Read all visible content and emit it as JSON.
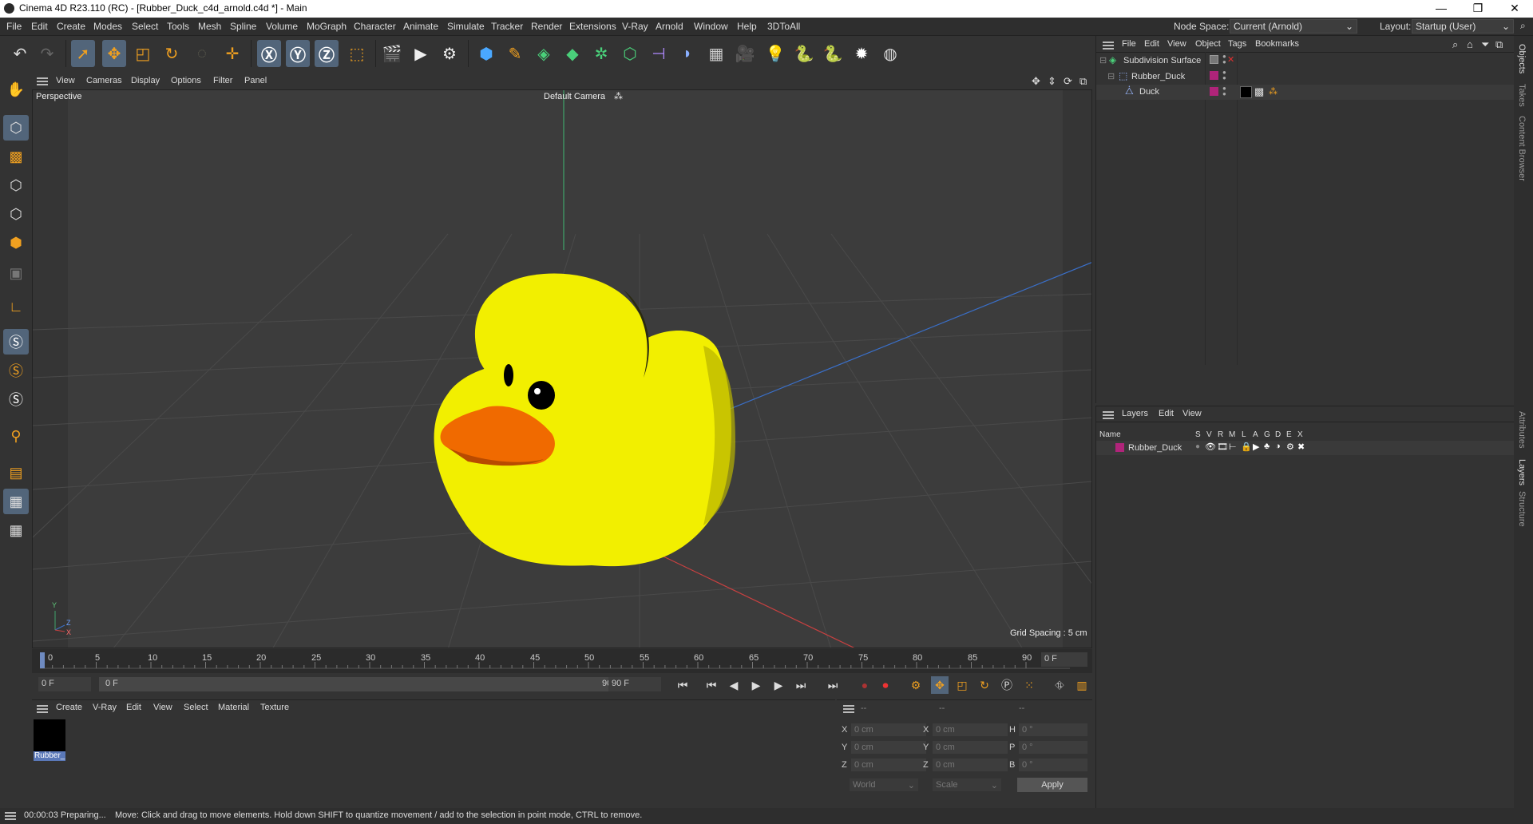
{
  "window": {
    "title": "Cinema 4D R23.110 (RC) - [Rubber_Duck_c4d_arnold.c4d *] - Main",
    "min": "—",
    "max": "❐",
    "close": "✕"
  },
  "menu": [
    "File",
    "Edit",
    "Create",
    "Modes",
    "Select",
    "Tools",
    "Mesh",
    "Spline",
    "Volume",
    "MoGraph",
    "Character",
    "Animate",
    "Simulate",
    "Tracker",
    "Render",
    "Extensions",
    "V-Ray",
    "Arnold",
    "Window",
    "Help",
    "3DToAll"
  ],
  "nodespace": {
    "label": "Node Space:",
    "value": "Current (Arnold)"
  },
  "layout": {
    "label": "Layout:",
    "value": "Startup (User)"
  },
  "viewport": {
    "menu": [
      "View",
      "Cameras",
      "Display",
      "Options",
      "Filter",
      "Panel"
    ],
    "view_name": "Perspective",
    "camera": "Default Camera",
    "grid_spacing": "Grid Spacing : 5 cm",
    "axes": {
      "y": "Y",
      "z": "Z",
      "x": "X"
    }
  },
  "timeline": {
    "ticks": [
      "0",
      "5",
      "10",
      "15",
      "20",
      "25",
      "30",
      "35",
      "40",
      "45",
      "50",
      "55",
      "60",
      "65",
      "70",
      "75",
      "80",
      "85",
      "90"
    ],
    "current_frame": "0 F",
    "start": "0 F",
    "range_start": "0 F",
    "range_end": "90 F",
    "end": "90 F",
    "frame_display": "0 F"
  },
  "material_panel": {
    "menu": [
      "Create",
      "V-Ray",
      "Edit",
      "View",
      "Select",
      "Material",
      "Texture"
    ],
    "materials": [
      {
        "name": "Rubber_"
      }
    ]
  },
  "coords": {
    "headers": [
      "--",
      "--",
      "--"
    ],
    "rows": [
      {
        "a": "X",
        "av": "0 cm",
        "b": "X",
        "bv": "0 cm",
        "c": "H",
        "cv": "0 °"
      },
      {
        "a": "Y",
        "av": "0 cm",
        "b": "Y",
        "bv": "0 cm",
        "c": "P",
        "cv": "0 °"
      },
      {
        "a": "Z",
        "av": "0 cm",
        "b": "Z",
        "bv": "0 cm",
        "c": "B",
        "cv": "0 °"
      }
    ],
    "space": "World",
    "mode": "Scale",
    "apply": "Apply"
  },
  "objects_panel": {
    "menu": [
      "File",
      "Edit",
      "View",
      "Object",
      "Tags",
      "Bookmarks"
    ],
    "items": [
      {
        "name": "Subdivision Surface",
        "indent": 0
      },
      {
        "name": "Rubber_Duck",
        "indent": 1
      },
      {
        "name": "Duck",
        "indent": 2
      }
    ]
  },
  "layers_panel": {
    "menu": [
      "Layers",
      "Edit",
      "View"
    ],
    "columns": [
      "Name",
      "S",
      "V",
      "R",
      "M",
      "L",
      "A",
      "G",
      "D",
      "E",
      "X"
    ],
    "items": [
      {
        "name": "Rubber_Duck",
        "color": "#b0247a"
      }
    ]
  },
  "right_tabs": [
    "Objects",
    "Takes",
    "Content Browser",
    "Attributes",
    "Layers",
    "Structure"
  ],
  "status": {
    "time": "00:00:03 Preparing...",
    "message": "Move: Click and drag to move elements. Hold down SHIFT to quantize movement / add to the selection in point mode, CTRL to remove."
  },
  "colors": {
    "accent": "#52657a",
    "duck": "#f2ef00",
    "beak": "#f06a00",
    "layer": "#b0247a"
  }
}
